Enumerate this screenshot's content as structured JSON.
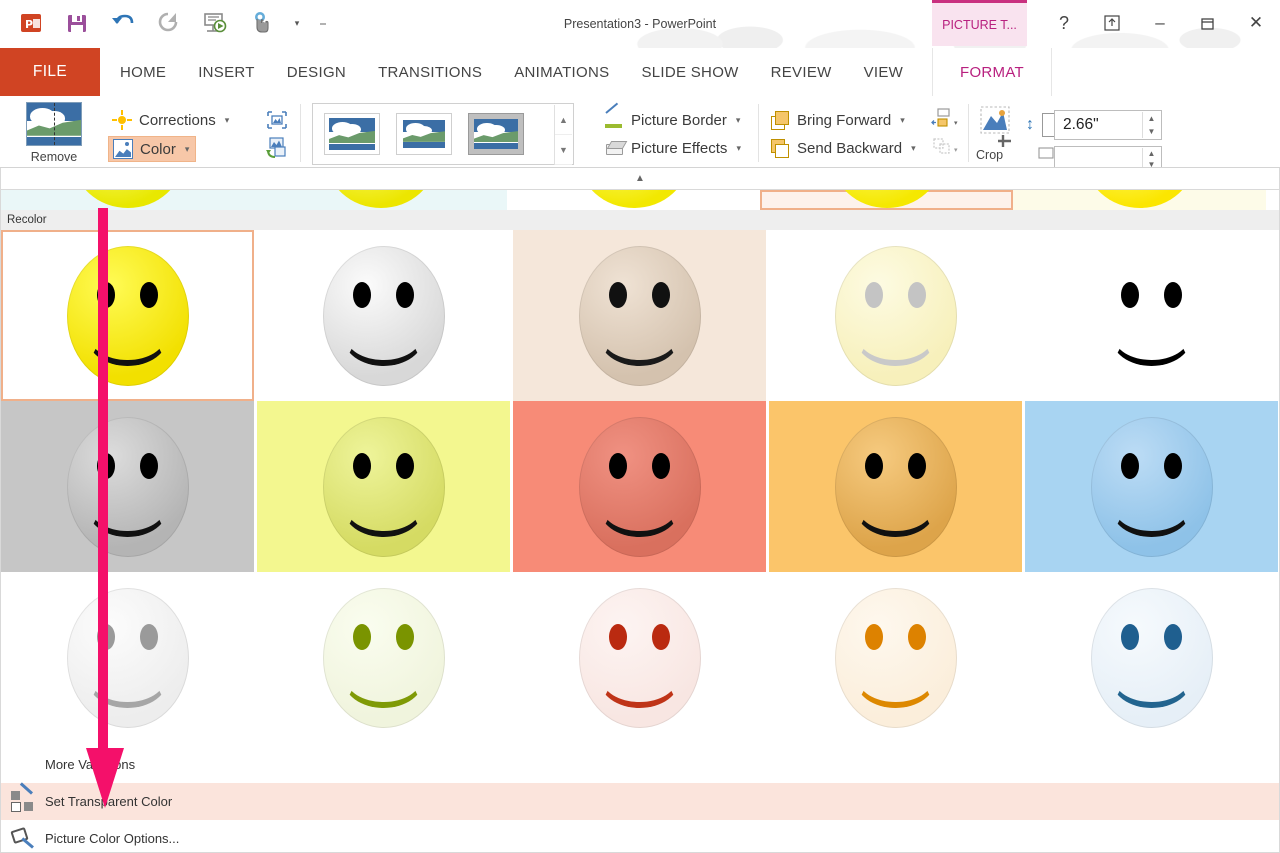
{
  "titlebar": {
    "doc_title": "Presentation3 - PowerPoint",
    "contextual_tab_title": "PICTURE T...",
    "help_label": "?",
    "ribbon_display_label": "⤒",
    "minimize_label": "–",
    "restore_label": "❐",
    "close_label": "✕",
    "account_caret": "▾"
  },
  "qat": {
    "app_icon": "powerpoint-logo",
    "save": "save-icon",
    "undo": "undo-icon",
    "redo": "redo-icon",
    "slideshow": "start-slideshow-icon",
    "touch": "touch-mode-icon",
    "touch_caret": "▾",
    "customize": "⎯"
  },
  "tabs": {
    "file": "FILE",
    "items": [
      "HOME",
      "INSERT",
      "DESIGN",
      "TRANSITIONS",
      "ANIMATIONS",
      "SLIDE SHOW",
      "REVIEW",
      "VIEW"
    ],
    "contextual": "FORMAT"
  },
  "ribbon": {
    "remove_background_label": "Remove",
    "corrections_label": "Corrections",
    "corrections_caret": "▾",
    "color_label": "Color",
    "color_caret": "▾",
    "picture_border_label": "Picture Border",
    "picture_border_caret": "▾",
    "picture_effects_label": "Picture Effects",
    "picture_effects_caret": "▾",
    "bring_forward_label": "Bring Forward",
    "bring_forward_caret": "▾",
    "send_backward_label": "Send Backward",
    "send_backward_caret": "▾",
    "crop_label": "Crop",
    "height_value": "2.66\"",
    "gallery_scroll_up": "▲",
    "gallery_scroll_down": "▼",
    "spin_up": "▲",
    "spin_down": "▼"
  },
  "collapse_bar": {
    "caret": "▲"
  },
  "gallery": {
    "section_header": "Recolor",
    "saturation_partial_row": [
      {
        "bg": "#eaf7f8",
        "face": "#e8e800",
        "selected": false
      },
      {
        "bg": "#eaf7f8",
        "face": "#ece600",
        "selected": false
      },
      {
        "bg": "#ffffff",
        "face": "#f2e800",
        "selected": false
      },
      {
        "bg": "#fdf2ec",
        "face": "#f5e800",
        "selected": true
      },
      {
        "bg": "#fdfbe8",
        "face": "#fbe600",
        "selected": false
      }
    ],
    "recolor_rows": [
      [
        {
          "name": "no-recolor",
          "bg": "#ffffff",
          "face_from": "#fffb55",
          "face_to": "#f2e000",
          "eye": "#000000",
          "mouth": "#111111",
          "selected": true
        },
        {
          "name": "grayscale",
          "bg": "#ffffff",
          "face_from": "#fbfbfb",
          "face_to": "#d8d8d8",
          "eye": "#000000",
          "mouth": "#111111",
          "selected": false
        },
        {
          "name": "sepia",
          "bg": "#f5e7da",
          "face_from": "#efe2d4",
          "face_to": "#d4c2ae",
          "eye": "#111111",
          "mouth": "#1a1a1a",
          "selected": false
        },
        {
          "name": "washout",
          "bg": "#ffffff",
          "face_from": "#fdfbe2",
          "face_to": "#f7f0bb",
          "eye": "#c4c4c4",
          "mouth": "#c9c9c9",
          "selected": false
        },
        {
          "name": "black-and-white",
          "bg": "#ffffff",
          "face_from": "transparent",
          "face_to": "transparent",
          "eye": "#000000",
          "mouth": "#000000",
          "selected": false
        }
      ],
      [
        {
          "name": "gray-accent",
          "bg": "#c6c6c6",
          "face_from": "#dcdcdc",
          "face_to": "#b4b4b4",
          "eye": "#000000",
          "mouth": "#111111",
          "selected": false
        },
        {
          "name": "yellow-green-accent",
          "bg": "#f3f78f",
          "face_from": "#eef49a",
          "face_to": "#d5db63",
          "eye": "#000000",
          "mouth": "#111111",
          "selected": false
        },
        {
          "name": "red-accent",
          "bg": "#f78b77",
          "face_from": "#f09182",
          "face_to": "#d9705e",
          "eye": "#000000",
          "mouth": "#111111",
          "selected": false
        },
        {
          "name": "orange-accent",
          "bg": "#fbc56a",
          "face_from": "#f6ca7f",
          "face_to": "#dda44a",
          "eye": "#000000",
          "mouth": "#111111",
          "selected": false
        },
        {
          "name": "blue-accent",
          "bg": "#a8d4f2",
          "face_from": "#bcdcf5",
          "face_to": "#8ec2e8",
          "eye": "#000000",
          "mouth": "#111111",
          "selected": false
        }
      ],
      [
        {
          "name": "gray-light",
          "bg": "#ffffff",
          "face_from": "#fcfcfc",
          "face_to": "#ededed",
          "eye": "#9a9a9a",
          "mouth": "#a6a6a6",
          "selected": false
        },
        {
          "name": "olive-light",
          "bg": "#ffffff",
          "face_from": "#fafdef",
          "face_to": "#f0f4dd",
          "eye": "#7a9400",
          "mouth": "#7f9a06",
          "selected": false
        },
        {
          "name": "dark-red-light",
          "bg": "#ffffff",
          "face_from": "#fdf4f2",
          "face_to": "#f8e6e2",
          "eye": "#ba2a10",
          "mouth": "#bf3418",
          "selected": false
        },
        {
          "name": "orange-light",
          "bg": "#ffffff",
          "face_from": "#fef8ee",
          "face_to": "#fbeedb",
          "eye": "#dd8200",
          "mouth": "#dd8800",
          "selected": false
        },
        {
          "name": "blue-light",
          "bg": "#ffffff",
          "face_from": "#f6fafd",
          "face_to": "#e6eff7",
          "eye": "#1f5f8f",
          "mouth": "#22648f",
          "selected": false
        }
      ]
    ]
  },
  "dropdown_menu": {
    "items": [
      {
        "name": "more-variations",
        "label": "More Variations",
        "icon": "color-wheel-icon",
        "highlighted": false
      },
      {
        "name": "set-transparent-color",
        "label": "Set Transparent Color",
        "icon": "transparent-color-icon",
        "highlighted": true
      },
      {
        "name": "picture-color-options",
        "label": "Picture Color Options...",
        "icon": "paint-bucket-icon",
        "highlighted": false
      }
    ]
  },
  "annotation": {
    "arrow_color": "#f4106a",
    "points_to": "set-transparent-color"
  }
}
